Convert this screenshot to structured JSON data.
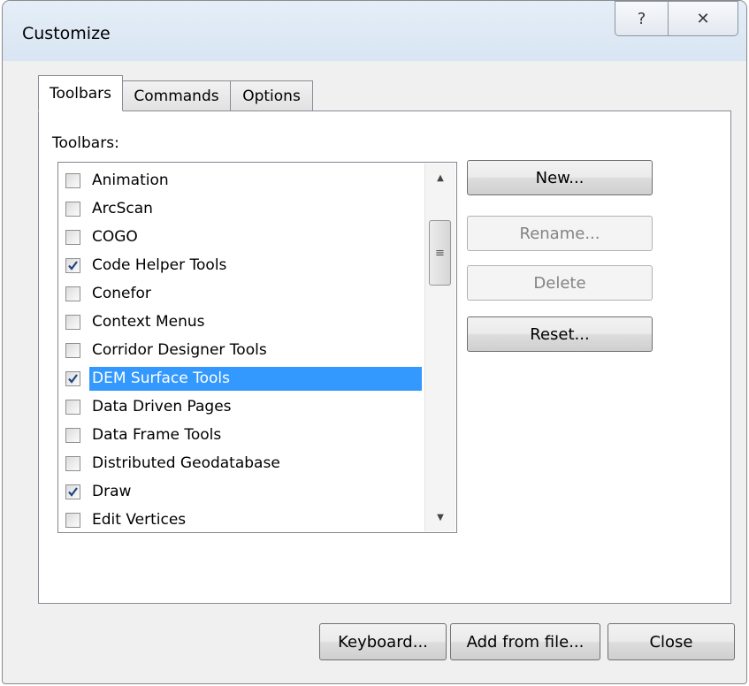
{
  "window": {
    "title": "Customize",
    "help_icon": "?",
    "close_icon": "✕"
  },
  "tabs": [
    {
      "label": "Toolbars",
      "active": true
    },
    {
      "label": "Commands",
      "active": false
    },
    {
      "label": "Options",
      "active": false
    }
  ],
  "panel": {
    "label": "Toolbars:"
  },
  "toolbars": [
    {
      "label": "Animation",
      "checked": false,
      "selected": false
    },
    {
      "label": "ArcScan",
      "checked": false,
      "selected": false
    },
    {
      "label": "COGO",
      "checked": false,
      "selected": false
    },
    {
      "label": "Code Helper Tools",
      "checked": true,
      "selected": false
    },
    {
      "label": "Conefor",
      "checked": false,
      "selected": false
    },
    {
      "label": "Context Menus",
      "checked": false,
      "selected": false
    },
    {
      "label": "Corridor Designer Tools",
      "checked": false,
      "selected": false
    },
    {
      "label": "DEM Surface Tools",
      "checked": true,
      "selected": true
    },
    {
      "label": "Data Driven Pages",
      "checked": false,
      "selected": false
    },
    {
      "label": "Data Frame Tools",
      "checked": false,
      "selected": false
    },
    {
      "label": "Distributed Geodatabase",
      "checked": false,
      "selected": false
    },
    {
      "label": "Draw",
      "checked": true,
      "selected": false
    },
    {
      "label": "Edit Vertices",
      "checked": false,
      "selected": false
    }
  ],
  "buttons": {
    "new": "New...",
    "rename": "Rename...",
    "delete": "Delete",
    "reset": "Reset...",
    "keyboard": "Keyboard...",
    "add_from_file": "Add from file...",
    "close": "Close"
  },
  "colors": {
    "selection": "#3399ff",
    "dialog_bg": "#f0f0f0"
  }
}
